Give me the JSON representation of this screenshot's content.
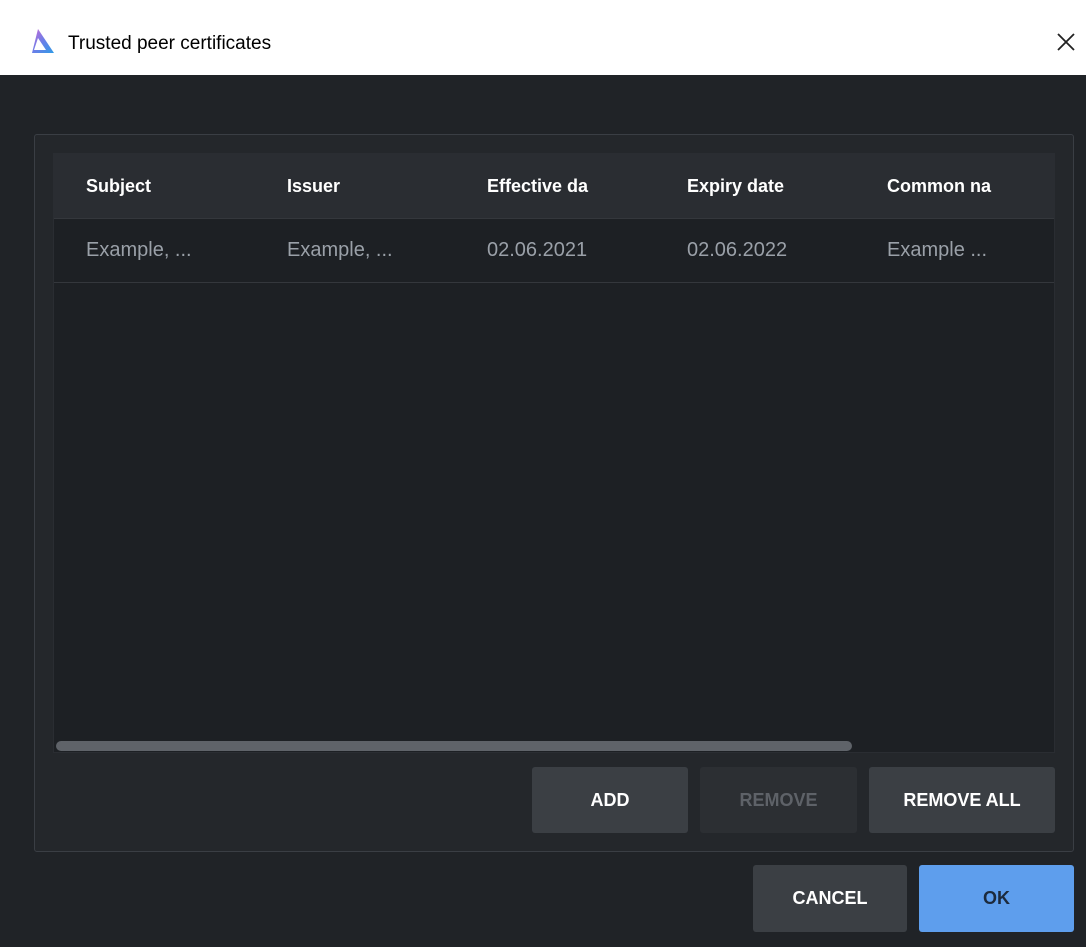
{
  "window": {
    "title": "Trusted peer certificates",
    "app_icon": "app-logo-icon",
    "close_icon": "close-icon"
  },
  "table": {
    "columns": [
      "Subject",
      "Issuer",
      "Effective da",
      "Expiry date",
      "Common na"
    ],
    "rows": [
      [
        "Example, ...",
        "Example, ...",
        "02.06.2021",
        "02.06.2022",
        "Example ..."
      ]
    ]
  },
  "actions": {
    "add": "ADD",
    "remove": "REMOVE",
    "remove_all": "REMOVE ALL"
  },
  "footer": {
    "cancel": "CANCEL",
    "ok": "OK"
  },
  "colors": {
    "background": "#202327",
    "accent": "#5e9eed",
    "text_primary": "#ffffff",
    "text_secondary": "#9aa0a8",
    "text_disabled": "#5e6268"
  }
}
